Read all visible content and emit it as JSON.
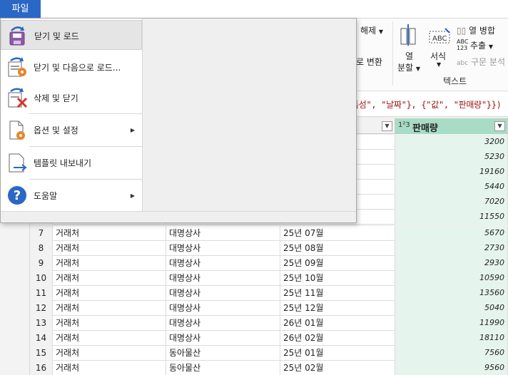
{
  "file_tab": {
    "label": "파일"
  },
  "file_menu": {
    "items": [
      {
        "label": "닫기 및 로드"
      },
      {
        "label": "닫기 및 다음으로 로드..."
      },
      {
        "label": "삭제 및 닫기"
      },
      {
        "label": "옵션 및 설정"
      },
      {
        "label": "템플릿 내보내기"
      },
      {
        "label": "도움말"
      }
    ]
  },
  "ribbon": {
    "unpivot_label": "해제",
    "convert_label": "로 변환",
    "split_column": {
      "line1": "열",
      "line2": "분할"
    },
    "format_label": "서식",
    "merge_columns": "열 병합",
    "extract": "추출",
    "parse": "구문 분석",
    "group_text": "텍스트",
    "abc_glyph": "ABC",
    "abc123_glyph": "ABC 123"
  },
  "formula": {
    "text": "특성\", \"날짜\"}, {\"값\", \"판매량\"}})"
  },
  "grid": {
    "selected_column": {
      "type_icon": "1²3",
      "title": "판매량"
    },
    "top_values": [
      "3200",
      "5230",
      "19160",
      "5440",
      "7020",
      "11550"
    ],
    "rows": [
      {
        "num": "7",
        "a": "거래처",
        "b": "대명상사",
        "c": "25년 07월",
        "d": "5670"
      },
      {
        "num": "8",
        "a": "거래처",
        "b": "대명상사",
        "c": "25년 08월",
        "d": "2730"
      },
      {
        "num": "9",
        "a": "거래처",
        "b": "대명상사",
        "c": "25년 09월",
        "d": "2930"
      },
      {
        "num": "10",
        "a": "거래처",
        "b": "대명상사",
        "c": "25년 10월",
        "d": "10590"
      },
      {
        "num": "11",
        "a": "거래처",
        "b": "대명상사",
        "c": "25년 11월",
        "d": "13560"
      },
      {
        "num": "12",
        "a": "거래처",
        "b": "대명상사",
        "c": "25년 12월",
        "d": "5040"
      },
      {
        "num": "13",
        "a": "거래처",
        "b": "대명상사",
        "c": "26년 01월",
        "d": "11990"
      },
      {
        "num": "14",
        "a": "거래처",
        "b": "대명상사",
        "c": "26년 02월",
        "d": "18110"
      },
      {
        "num": "15",
        "a": "거래처",
        "b": "동아물산",
        "c": "25년 01월",
        "d": "7560"
      },
      {
        "num": "16",
        "a": "거래처",
        "b": "동아물산",
        "c": "25년 02월",
        "d": "9560"
      }
    ]
  },
  "colors": {
    "accent": "#2b67c5",
    "selected_column": "#a9dcc6",
    "selected_cells": "#e6f4ee"
  }
}
